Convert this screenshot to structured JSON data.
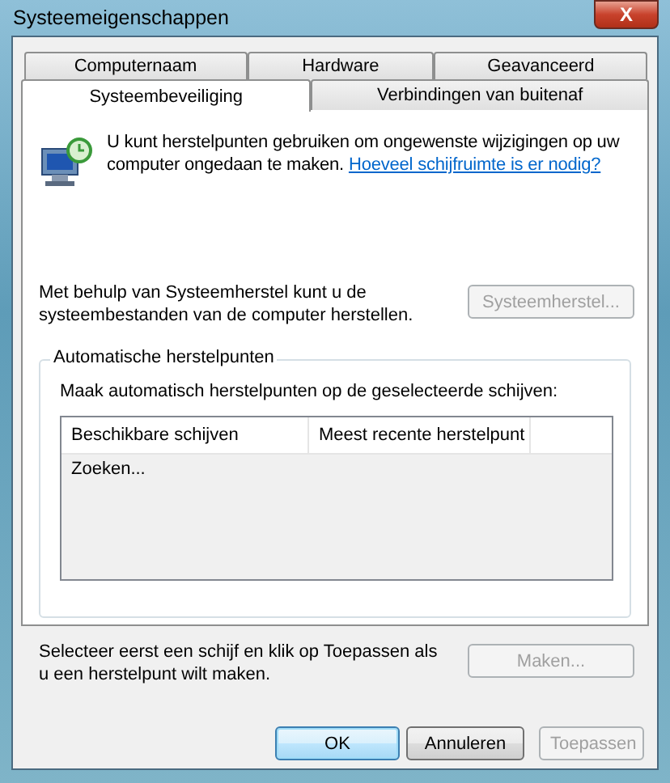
{
  "window": {
    "title": "Systeemeigenschappen",
    "close": "X"
  },
  "tab_rows": [
    [
      {
        "label": "Computernaam",
        "selected": false
      },
      {
        "label": "Hardware",
        "selected": false
      },
      {
        "label": "Geavanceerd",
        "selected": false
      }
    ],
    [
      {
        "label": "Systeembeveiliging",
        "selected": true
      },
      {
        "label": "Verbindingen van buitenaf",
        "selected": false
      }
    ]
  ],
  "intro": {
    "text": "U kunt herstelpunten gebruiken om ongewenste wijzigingen op uw computer ongedaan te maken.",
    "link": "Hoeveel schijfruimte is er nodig?"
  },
  "restore": {
    "text": "Met behulp van Systeemherstel kunt u de systeembestanden van de computer herstellen.",
    "button": {
      "label": "Systeemherstel...",
      "disabled": true
    }
  },
  "group": {
    "title": "Automatische herstelpunten",
    "label": "Maak automatisch herstelpunten op de geselecteerde schijven:",
    "columns": [
      "Beschikbare schijven",
      "Meest recente herstelpunt"
    ],
    "rows": [
      "Zoeken..."
    ]
  },
  "create": {
    "text": "Selecteer eerst een schijf en klik op Toepassen als u een herstelpunt wilt maken.",
    "button": {
      "label": "Maken...",
      "disabled": true
    }
  },
  "buttons": [
    {
      "label": "OK",
      "default": true,
      "disabled": false
    },
    {
      "label": "Annuleren",
      "default": false,
      "disabled": false
    },
    {
      "label": "Toepassen",
      "default": false,
      "disabled": true
    }
  ]
}
